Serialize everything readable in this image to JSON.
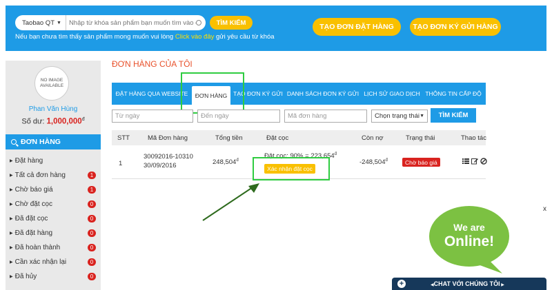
{
  "header": {
    "search_category": "Taobao QT",
    "search_placeholder": "Nhập từ khóa sản phẩm bạn muốn tìm vào đây...",
    "search_button": "TÌM KIẾM",
    "hint_prefix": "Nếu bạn chưa tìm thấy sản phẩm mong muốn vui lòng",
    "hint_link": "Click vào đây",
    "hint_suffix": "gửi yêu cầu từ khóa",
    "create_order_button": "TẠO ĐƠN ĐẶT HÀNG",
    "create_deposit_button": "TẠO ĐƠN KÝ GỬI HÀNG"
  },
  "sidebar": {
    "avatar_text_1": "NO IMAGE",
    "avatar_text_2": "AVAILABLE",
    "user_name": "Phan Văn Hùng",
    "balance_label": "Số dư:",
    "balance_value": "1,000,000",
    "currency": "đ",
    "menu_title": "ĐƠN HÀNG",
    "items": [
      {
        "label": "Đặt hàng",
        "badge": ""
      },
      {
        "label": "Tất cả đơn hàng",
        "badge": "1"
      },
      {
        "label": "Chờ báo giá",
        "badge": "1"
      },
      {
        "label": "Chờ đặt cọc",
        "badge": "0"
      },
      {
        "label": "Đã đặt cọc",
        "badge": "0"
      },
      {
        "label": "Đã đặt hàng",
        "badge": "0"
      },
      {
        "label": "Đã hoàn thành",
        "badge": "0"
      },
      {
        "label": "Cần xác nhận lại",
        "badge": "0"
      },
      {
        "label": "Đã hủy",
        "badge": "0"
      }
    ]
  },
  "main": {
    "title": "ĐƠN HÀNG CỦA TÔI",
    "tabs": [
      {
        "label": "ĐẶT HÀNG QUA WEBSITE"
      },
      {
        "label": "ĐƠN HÀNG"
      },
      {
        "label": "TẠO ĐƠN KÝ GỬI"
      },
      {
        "label": "DANH SÁCH ĐƠN KÝ GỬI"
      },
      {
        "label": "LỊCH SỬ GIAO DỊCH"
      },
      {
        "label": "THÔNG TIN CẤP ĐỘ"
      }
    ],
    "filters": {
      "from_date": "Từ ngày",
      "to_date": "Đến ngày",
      "order_code": "Mã đơn hàng",
      "status_select": "Chọn trạng thái",
      "find_button": "TÌM KIẾM"
    },
    "table": {
      "headers": [
        "STT",
        "Mã Đơn hàng",
        "Tổng tiền",
        "Đặt cọc",
        "Còn nợ",
        "Trạng thái",
        "Thao tác"
      ],
      "rows": [
        {
          "stt": "1",
          "code": "30092016-10310",
          "date": "30/09/2016",
          "total": "248,504",
          "deposit_text": "Đặt cọc: 90% = 223,654",
          "confirm_button": "Xác nhận đặt cọc",
          "debt": "-248,504",
          "status": "Chờ báo giá"
        }
      ]
    }
  },
  "widgets": {
    "close": "x",
    "online_line1": "We are",
    "online_line2": "Online!",
    "chat_label": "CHAT VỚI CHÚNG TÔI"
  },
  "colors": {
    "primary": "#1e9be6",
    "accent": "#f9c000",
    "danger": "#d9231f",
    "title": "#e8502a",
    "highlight": "#2ecc40",
    "chat_bar": "#16385a",
    "bubble": "#7cc142"
  }
}
